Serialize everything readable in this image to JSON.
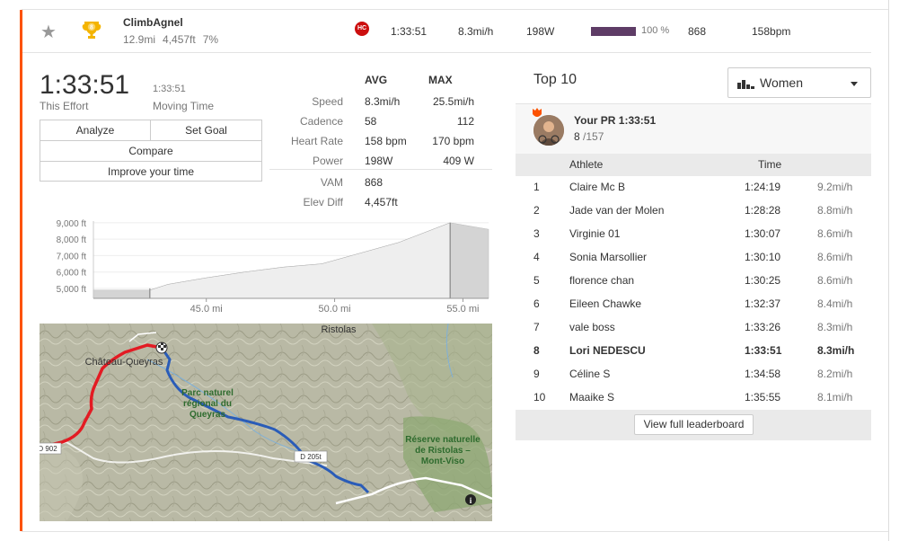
{
  "segment": {
    "name": "ClimbAgnel",
    "distance": "12.9mi",
    "elevation": "4,457ft",
    "grade": "7%",
    "category": "HC",
    "time": "1:33:51",
    "speed": "8.3mi/h",
    "power": "198W",
    "power_bar_fraction": 1.0,
    "power_pct": "100 %",
    "vam": "868",
    "heart_rate": "158bpm",
    "trophy_rank": "8"
  },
  "effort": {
    "elapsed_time": "1:33:51",
    "elapsed_label": "This Effort",
    "moving_time": "1:33:51",
    "moving_label": "Moving Time"
  },
  "actions": {
    "analyze": "Analyze",
    "set_goal": "Set Goal",
    "compare": "Compare",
    "improve": "Improve your time"
  },
  "stats": {
    "avg_header": "AVG",
    "max_header": "MAX",
    "rows": [
      {
        "label": "Speed",
        "avg": "8.3mi/h",
        "max": "25.5mi/h"
      },
      {
        "label": "Cadence",
        "avg": "58",
        "max": "112"
      },
      {
        "label": "Heart Rate",
        "avg": "158 bpm",
        "max": "170 bpm"
      },
      {
        "label": "Power",
        "avg": "198W",
        "max": "409 W"
      },
      {
        "label": "VAM",
        "avg": "868",
        "max": ""
      },
      {
        "label": "Elev Diff",
        "avg": "4,457ft",
        "max": ""
      }
    ]
  },
  "elevation_chart": {
    "y_ticks": [
      "9,000 ft",
      "8,000 ft",
      "7,000 ft",
      "6,000 ft",
      "5,000 ft"
    ],
    "x_ticks": [
      "45.0 mi",
      "50.0 mi",
      "55.0 mi"
    ]
  },
  "chart_data": {
    "type": "area",
    "xlabel": "",
    "ylabel": "",
    "x": [
      41.6,
      42.8,
      43.5,
      45.0,
      46.5,
      48.0,
      49.5,
      51.0,
      52.5,
      54.0,
      54.5,
      56.0
    ],
    "values": [
      4900,
      4900,
      5250,
      5650,
      6000,
      6300,
      6500,
      7150,
      7800,
      8700,
      9000,
      8600
    ],
    "xlim": [
      40.6,
      56.0
    ],
    "ylim": [
      4400,
      9100
    ],
    "highlight_range": [
      42.8,
      54.5
    ]
  },
  "map": {
    "labels": {
      "village_top": "Ristolas",
      "village_left": "Château-Queyras",
      "park_1": "Parc naturel",
      "park_2": "régional du",
      "park_3": "Queyras",
      "reserve_1": "Réserve naturelle",
      "reserve_2": "de Ristolas –",
      "reserve_3": "Mont-Viso",
      "road": "D 205t",
      "road_left": "D 902"
    }
  },
  "leaderboard": {
    "title": "Top 10",
    "filter_label": "Women",
    "pr_label": "Your PR 1:33:51",
    "pr_rank": "8",
    "pr_total": "/157",
    "col_athlete": "Athlete",
    "col_time": "Time",
    "rows": [
      {
        "rank": "1",
        "name": "Claire Mc B",
        "time": "1:24:19",
        "speed": "9.2mi/h"
      },
      {
        "rank": "2",
        "name": "Jade van der Molen",
        "time": "1:28:28",
        "speed": "8.8mi/h"
      },
      {
        "rank": "3",
        "name": "Virginie 01",
        "time": "1:30:07",
        "speed": "8.6mi/h"
      },
      {
        "rank": "4",
        "name": "Sonia Marsollier",
        "time": "1:30:10",
        "speed": "8.6mi/h"
      },
      {
        "rank": "5",
        "name": "florence chan",
        "time": "1:30:25",
        "speed": "8.6mi/h"
      },
      {
        "rank": "6",
        "name": "Eileen Chawke",
        "time": "1:32:37",
        "speed": "8.4mi/h"
      },
      {
        "rank": "7",
        "name": "vale boss",
        "time": "1:33:26",
        "speed": "8.3mi/h"
      },
      {
        "rank": "8",
        "name": "Lori NEDESCU",
        "time": "1:33:51",
        "speed": "8.3mi/h"
      },
      {
        "rank": "9",
        "name": "Céline S",
        "time": "1:34:58",
        "speed": "8.2mi/h"
      },
      {
        "rank": "10",
        "name": "Maaike S",
        "time": "1:35:55",
        "speed": "8.1mi/h"
      }
    ],
    "view_full": "View full leaderboard"
  }
}
